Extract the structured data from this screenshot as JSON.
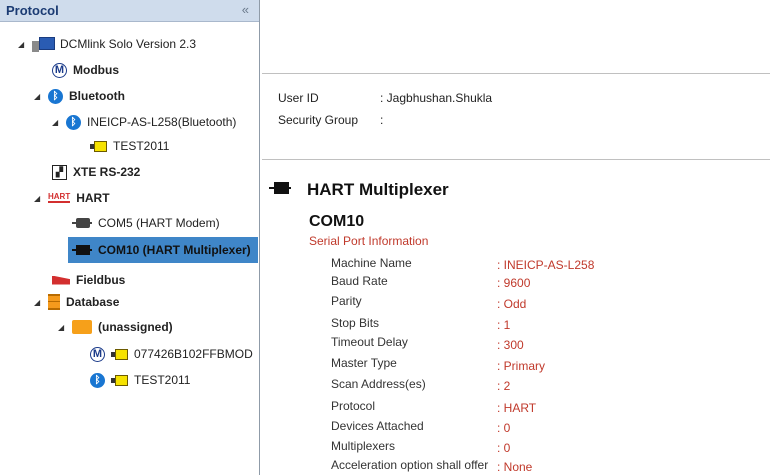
{
  "left_pane": {
    "title": "Protocol",
    "collapse_glyph": "«",
    "tree": [
      {
        "label": "DCMlink Solo Version 2.3",
        "icon": "computer-icon",
        "bold": false
      },
      {
        "label": "Modbus",
        "icon": "modbus-icon",
        "bold": true
      },
      {
        "label": "Bluetooth",
        "icon": "bluetooth-icon",
        "bold": true
      },
      {
        "label": "INEICP-AS-L258(Bluetooth)",
        "icon": "bluetooth-icon",
        "bold": false
      },
      {
        "label": "TEST2011",
        "icon": "device-tag-icon",
        "bold": false
      },
      {
        "label": "XTE RS-232",
        "icon": "xte-icon",
        "bold": true
      },
      {
        "label": "HART",
        "icon": "hart-icon",
        "bold": true
      },
      {
        "label": "COM5 (HART Modem)",
        "icon": "hart-modem-icon",
        "bold": false
      },
      {
        "label": "COM10 (HART Multiplexer)",
        "icon": "hart-multiplexer-icon",
        "bold": true,
        "selected": true
      },
      {
        "label": "Fieldbus",
        "icon": "fieldbus-icon",
        "bold": true
      },
      {
        "label": "Database",
        "icon": "database-icon",
        "bold": true
      },
      {
        "label": "(unassigned)",
        "icon": "folder-icon",
        "bold": true
      },
      {
        "label": "077426B102FFBMOD",
        "icon": "device-tag-icon",
        "bold": false
      },
      {
        "label": "TEST2011",
        "icon": "device-tag-icon",
        "bold": false
      }
    ],
    "icon_glyphs": {
      "modbus": "M",
      "bluetooth": "ᛒ",
      "hart": "HART",
      "xte": "▞"
    }
  },
  "user_info": {
    "user_id_label": "User ID",
    "user_id_value": ": Jagbhushan.Shukla",
    "security_group_label": "Security Group",
    "security_group_value": ":"
  },
  "detail": {
    "section_title": "HART Multiplexer",
    "com_title": "COM10",
    "sub_title": "Serial Port Information",
    "properties": [
      {
        "label": "Machine Name",
        "value": ": INEICP-AS-L258"
      },
      {
        "label": "Baud Rate",
        "value": ": 9600"
      },
      {
        "label": "Parity",
        "value": ": Odd"
      },
      {
        "label": "Stop Bits",
        "value": ": 1"
      },
      {
        "label": "Timeout Delay",
        "value": ": 300"
      },
      {
        "label": "Master Type",
        "value": ": Primary"
      },
      {
        "label": "Scan Address(es)",
        "value": ": 2"
      },
      {
        "label": "Protocol",
        "value": ": HART"
      },
      {
        "label": "Devices Attached",
        "value": ": 0"
      },
      {
        "label": "Multiplexers",
        "value": ": 0"
      },
      {
        "label": "Acceleration option shall offer",
        "value": ": None"
      }
    ]
  },
  "colors": {
    "selection": "#3f86c8",
    "value_text": "#c0392b",
    "header_bg": "#cfdcec"
  }
}
